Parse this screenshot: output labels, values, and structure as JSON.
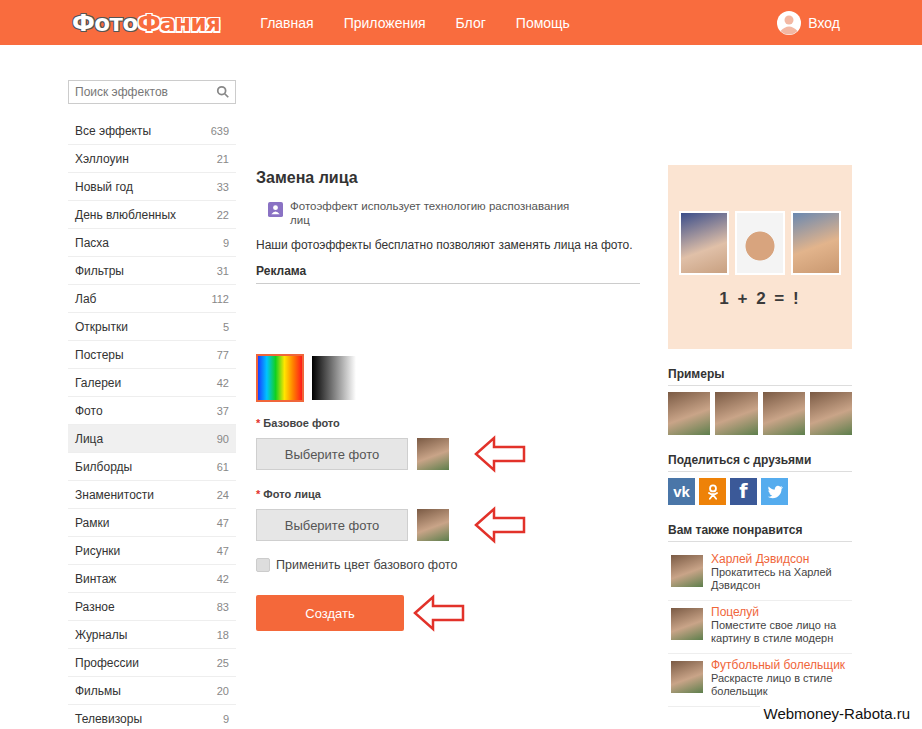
{
  "header": {
    "logo": [
      "Фото",
      "Фания"
    ],
    "nav": [
      {
        "label": "Главная"
      },
      {
        "label": "Приложения"
      },
      {
        "label": "Блог"
      },
      {
        "label": "Помощь"
      }
    ],
    "login": "Вход"
  },
  "sidebar": {
    "search_placeholder": "Поиск эффектов",
    "items": [
      {
        "label": "Все эффекты",
        "count": "639",
        "selected": false
      },
      {
        "label": "Хэллоуин",
        "count": "21",
        "selected": false
      },
      {
        "label": "Новый год",
        "count": "33",
        "selected": false
      },
      {
        "label": "День влюбленных",
        "count": "22",
        "selected": false
      },
      {
        "label": "Пасха",
        "count": "9",
        "selected": false
      },
      {
        "label": "Фильтры",
        "count": "31",
        "selected": false
      },
      {
        "label": "Лаб",
        "count": "112",
        "selected": false
      },
      {
        "label": "Открытки",
        "count": "5",
        "selected": false
      },
      {
        "label": "Постеры",
        "count": "77",
        "selected": false
      },
      {
        "label": "Галереи",
        "count": "42",
        "selected": false
      },
      {
        "label": "Фото",
        "count": "37",
        "selected": false
      },
      {
        "label": "Лица",
        "count": "90",
        "selected": true
      },
      {
        "label": "Билборды",
        "count": "61",
        "selected": false
      },
      {
        "label": "Знаменитости",
        "count": "24",
        "selected": false
      },
      {
        "label": "Рамки",
        "count": "47",
        "selected": false
      },
      {
        "label": "Рисунки",
        "count": "47",
        "selected": false
      },
      {
        "label": "Винтаж",
        "count": "42",
        "selected": false
      },
      {
        "label": "Разное",
        "count": "83",
        "selected": false
      },
      {
        "label": "Журналы",
        "count": "18",
        "selected": false
      },
      {
        "label": "Профессии",
        "count": "25",
        "selected": false
      },
      {
        "label": "Фильмы",
        "count": "20",
        "selected": false
      },
      {
        "label": "Телевизоры",
        "count": "9",
        "selected": false
      }
    ]
  },
  "main": {
    "title": "Замена лица",
    "notice": "Фотоэффект использует технологию распознавания лиц",
    "description": "Наши фотоэффекты бесплатно позволяют заменять лица на фото.",
    "ad_label": "Реклама",
    "color_modes": [
      {
        "kind": "color",
        "selected": true
      },
      {
        "kind": "grayscale",
        "selected": false
      }
    ],
    "fields": [
      {
        "required_mark": "*",
        "label": "Базовое фото",
        "button": "Выберите фото"
      },
      {
        "required_mark": "*",
        "label": "Фото лица",
        "button": "Выберите фото"
      }
    ],
    "checkbox": {
      "label": "Применить цвет базового фото",
      "checked": false
    },
    "submit": "Создать"
  },
  "right": {
    "banner": {
      "formula": "1 + 2 = !"
    },
    "examples_title": "Примеры",
    "share": {
      "title": "Поделиться с друзьями",
      "networks": [
        {
          "kind": "vk",
          "glyph": "vk",
          "color": "#4a76a8"
        },
        {
          "kind": "ok",
          "glyph": "",
          "color": "#ee8208"
        },
        {
          "kind": "facebook",
          "glyph": "f",
          "color": "#3b5998"
        },
        {
          "kind": "twitter",
          "glyph": "",
          "color": "#55acee"
        }
      ]
    },
    "related": {
      "title": "Вам также понравится",
      "items": [
        {
          "title": "Харлей Дэвидсон",
          "description": "Прокатитесь на Харлей Дэвидсон"
        },
        {
          "title": "Поцелуй",
          "description": "Поместите свое лицо на картину в стиле модерн"
        },
        {
          "title": "Футбольный болельщик",
          "description": "Раскрасте лицо в стиле болельщик"
        }
      ]
    }
  },
  "watermark": "Webmoney-Rabota.ru"
}
